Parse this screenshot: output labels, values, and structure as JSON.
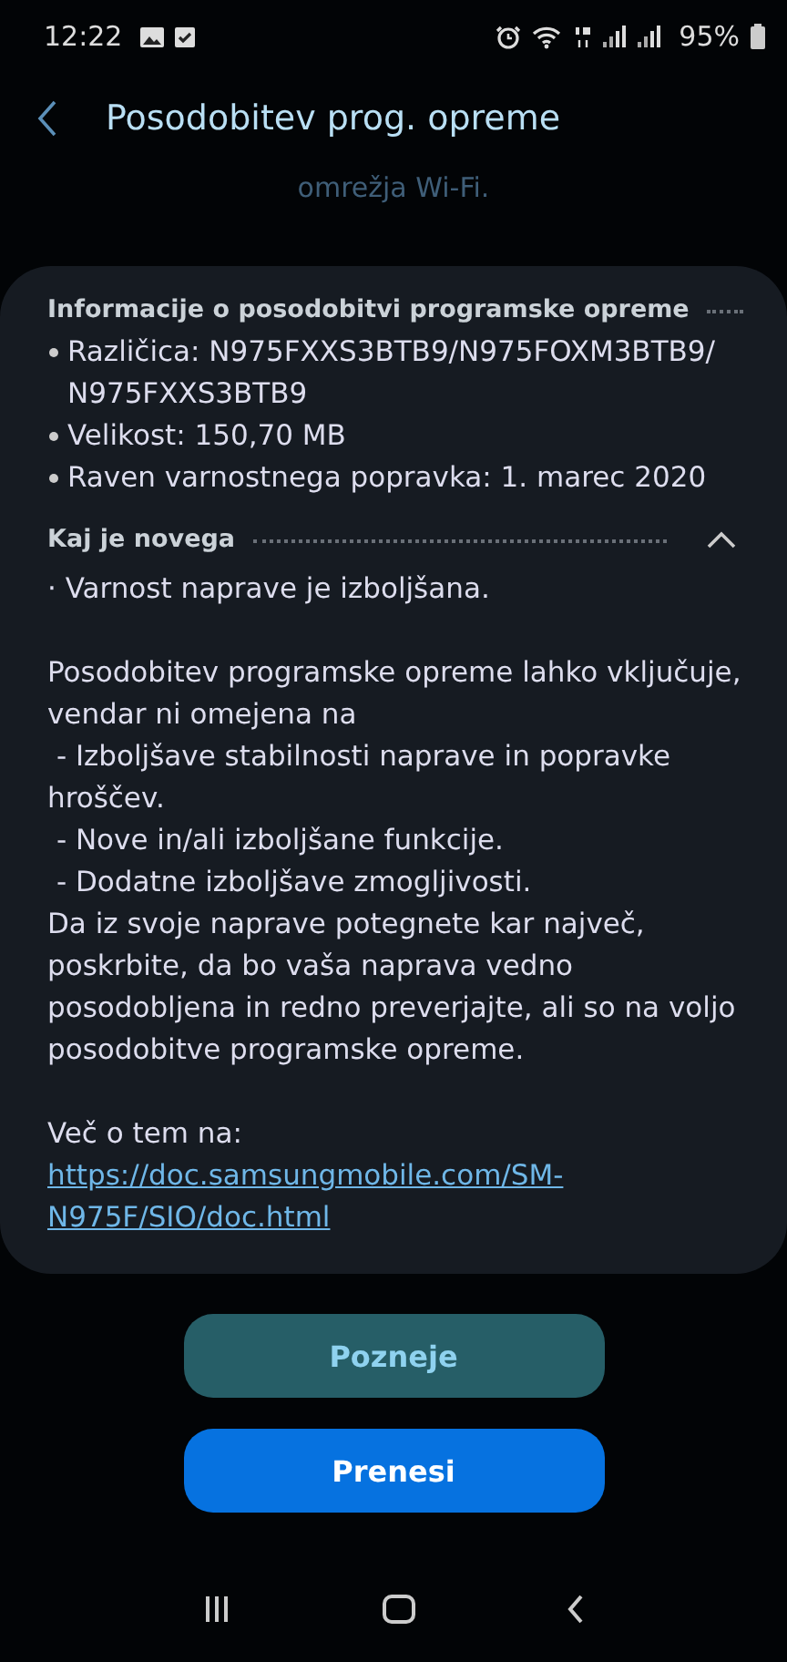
{
  "status_bar": {
    "time": "12:22",
    "battery": "95%"
  },
  "header": {
    "title": "Posodobitev prog. opreme"
  },
  "faded_text": "omrežja Wi-Fi.",
  "info_section": {
    "title": "Informacije o posodobitvi programske opreme",
    "items": [
      "Različica: N975FXXS3BTB9/N975FOXM3BTB9/ N975FXXS3BTB9",
      "Velikost: 150,70 MB",
      "Raven varnostnega popravka: 1. marec 2020"
    ]
  },
  "whats_new": {
    "title": "Kaj je novega",
    "expanded": true,
    "blocks": [
      [
        "· Varnost naprave je izboljšana."
      ],
      [
        "Posodobitev programske opreme lahko vključuje, vendar ni omejena na",
        " - Izboljšave stabilnosti naprave in popravke hroščev.",
        " - Nove in/ali izboljšane funkcije.",
        " - Dodatne izboljšave zmogljivosti.",
        "Da iz svoje naprave potegnete kar največ, poskrbite, da bo vaša naprava vedno posodobljena in redno preverjajte, ali so na voljo posodobitve programske opreme."
      ],
      [
        "Več o tem na:"
      ]
    ],
    "link": "https://doc.samsungmobile.com/SM-N975F/SIO/doc.html"
  },
  "buttons": [
    {
      "label": "Pozneje",
      "kind": "secondary"
    },
    {
      "label": "Prenesi",
      "kind": "primary"
    }
  ]
}
